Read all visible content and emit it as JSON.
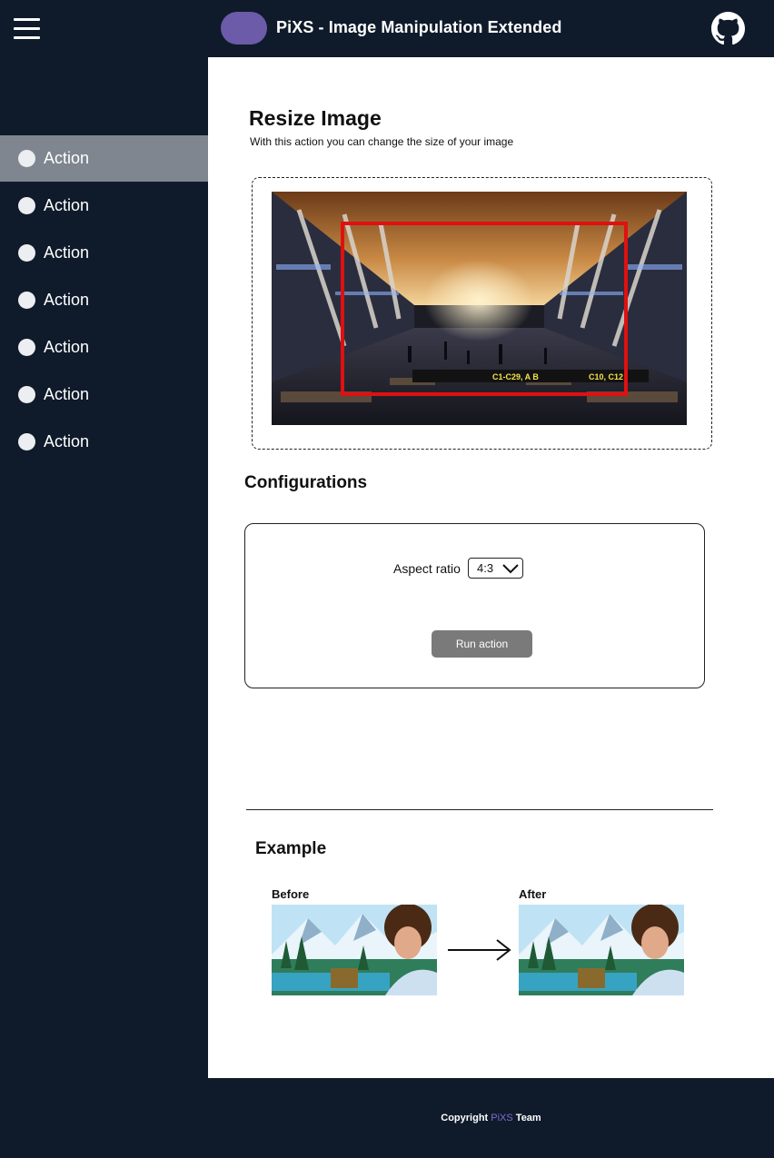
{
  "header": {
    "title": "PiXS - Image Manipulation Extended",
    "logo_color": "#6b5ba8",
    "menu_icon": "hamburger-menu-icon",
    "github_icon": "github-icon"
  },
  "sidebar": {
    "items": [
      {
        "label": "Action",
        "active": true
      },
      {
        "label": "Action",
        "active": false
      },
      {
        "label": "Action",
        "active": false
      },
      {
        "label": "Action",
        "active": false
      },
      {
        "label": "Action",
        "active": false
      },
      {
        "label": "Action",
        "active": false
      },
      {
        "label": "Action",
        "active": false
      }
    ]
  },
  "main": {
    "title": "Resize Image",
    "subtitle": "With this action you can change the size of your image",
    "preview": {
      "image_icon": "airport-terminal-photo",
      "crop_color": "#e01010",
      "sign_text_1": "C1-C29, A B",
      "sign_text_2": "C10, C12"
    }
  },
  "configurations": {
    "title": "Configurations",
    "aspect_ratio_label": "Aspect ratio",
    "aspect_ratio_value": "4:3",
    "run_button_label": "Run action"
  },
  "example": {
    "title": "Example",
    "before_label": "Before",
    "after_label": "After",
    "arrow_icon": "arrow-right-icon"
  },
  "footer": {
    "prefix": "Copyright ",
    "brand": "PiXS",
    "suffix": " Team",
    "brand_color": "#7d6bd1"
  }
}
